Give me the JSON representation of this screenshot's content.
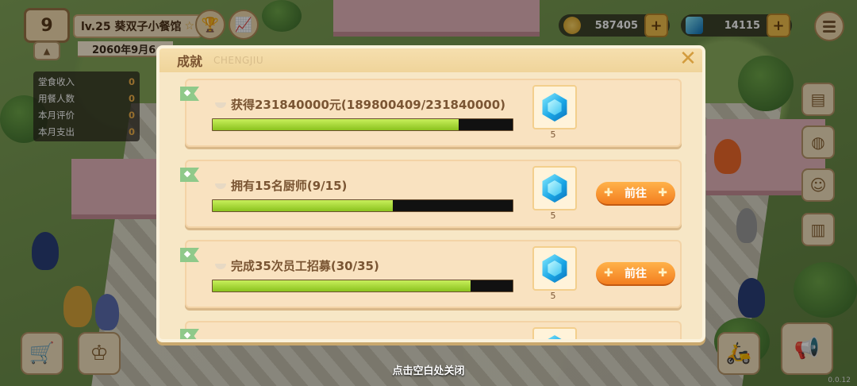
{
  "hud": {
    "level": "9",
    "shop_name": "lv.25 葵双子小餐馆",
    "shop_star": "☆",
    "date": "2060年9月6",
    "stats": [
      {
        "label": "堂食收入",
        "value": "0"
      },
      {
        "label": "用餐人数",
        "value": "0"
      },
      {
        "label": "本月评价",
        "value": "0"
      },
      {
        "label": "本月支出",
        "value": "0"
      }
    ],
    "gold": "587405",
    "gems": "14115",
    "version": "0.0.12"
  },
  "modal": {
    "title": "成就",
    "subtitle": "CHENGJIU",
    "close_symbol": "✕",
    "hint": "点击空白处关闭",
    "achievements": [
      {
        "label": "获得231840000元(189800409/231840000)",
        "progress": 0.82,
        "reward_count": "5",
        "button": ""
      },
      {
        "label": "拥有15名厨师(9/15)",
        "progress": 0.6,
        "reward_count": "5",
        "button": "前往"
      },
      {
        "label": "完成35次员工招募(30/35)",
        "progress": 0.86,
        "reward_count": "5",
        "button": "前往"
      }
    ]
  },
  "colors": {
    "progress_fill": "#8ac21e",
    "button_orange": "#f37e1f",
    "modal_bg": "#f7e7c6"
  }
}
